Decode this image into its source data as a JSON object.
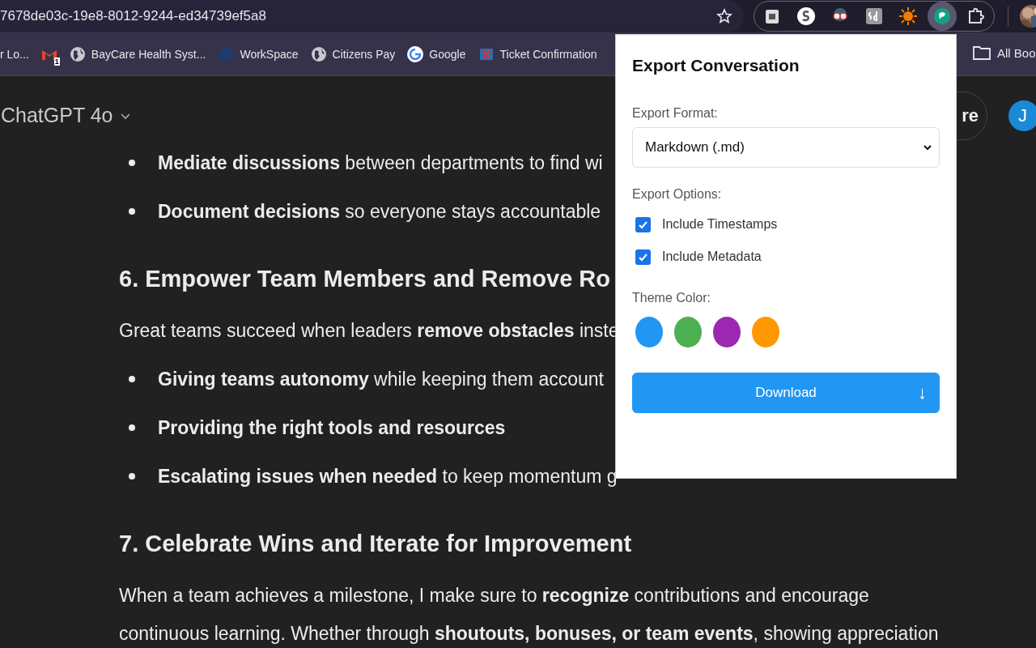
{
  "address_bar": {
    "url": "7678de03c-19e8-8012-9244-ed34739ef5a8"
  },
  "bookmarks": [
    {
      "kind": "none",
      "label": "r Lo..."
    },
    {
      "kind": "gmail",
      "badge": "1"
    },
    {
      "kind": "globe",
      "label": "BayCare Health Syst..."
    },
    {
      "kind": "workspace",
      "label": "WorkSpace"
    },
    {
      "kind": "globe",
      "label": "Citizens Pay"
    },
    {
      "kind": "google",
      "label": "Google"
    },
    {
      "kind": "ticket",
      "label": "Ticket Confirmation"
    }
  ],
  "bookmarks_folder": {
    "label": "All Boo"
  },
  "chat": {
    "model": "ChatGPT 4o",
    "share_label": "re",
    "avatar": "J",
    "blocks": [
      {
        "kind": "bullet",
        "text": "**Mediate discussions** between departments to find wi"
      },
      {
        "kind": "bullet",
        "text": "**Document decisions** so everyone stays accountable"
      },
      {
        "kind": "heading",
        "text": "6. Empower Team Members and Remove Ro"
      },
      {
        "kind": "paragraph",
        "text": "Great teams succeed when leaders **remove obstacles** inste"
      },
      {
        "kind": "bullet",
        "text": "**Giving teams autonomy** while keeping them account"
      },
      {
        "kind": "bullet",
        "text": "**Providing the right tools and resources**"
      },
      {
        "kind": "bullet",
        "text": "**Escalating issues when needed** to keep momentum g"
      },
      {
        "kind": "heading",
        "text": "7. Celebrate Wins and Iterate for Improvement"
      },
      {
        "kind": "paragraph",
        "text": "When a team achieves a milestone, I make sure to **recognize** contributions and encourage continuous learning. Whether through **shoutouts, bonuses, or team events**, showing appreciation"
      }
    ]
  },
  "popup": {
    "title": "Export Conversation",
    "format_label": "Export Format:",
    "format_value": "Markdown (.md)",
    "options_label": "Export Options:",
    "options": [
      {
        "label": "Include Timestamps",
        "checked": true
      },
      {
        "label": "Include Metadata",
        "checked": true
      }
    ],
    "theme_label": "Theme Color:",
    "colors": [
      {
        "color": "#2196f3"
      },
      {
        "color": "#4caf50"
      },
      {
        "color": "#9c27b0"
      },
      {
        "color": "#ff9800"
      }
    ],
    "download": {
      "label": "Download",
      "arrow": "↓"
    }
  }
}
